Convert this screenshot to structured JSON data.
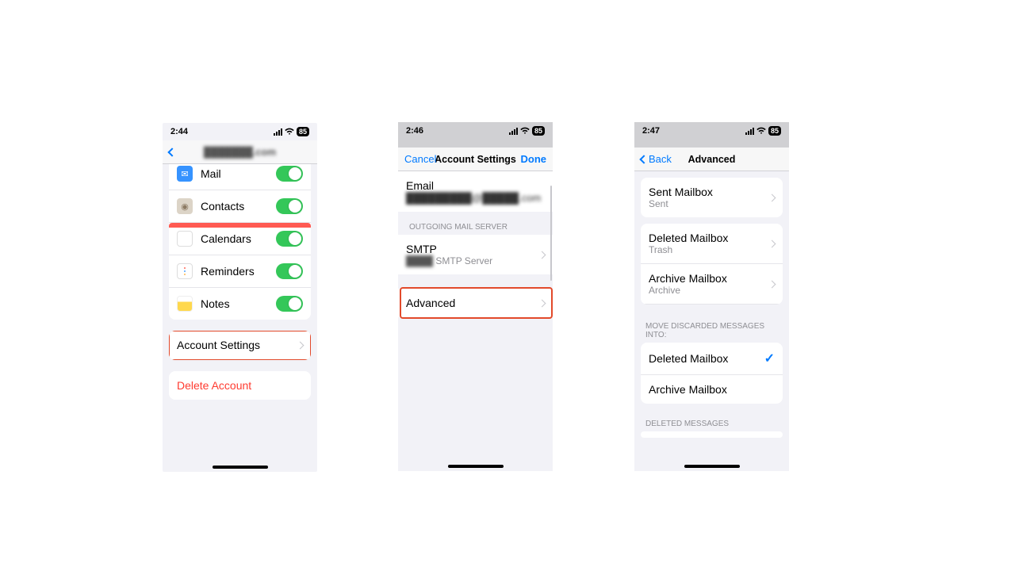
{
  "screens": {
    "a": {
      "time": "2:44",
      "battery": "85",
      "title": "███████.com",
      "list": [
        {
          "name": "Mail",
          "iconBg": "#3693ff"
        },
        {
          "name": "Contacts",
          "iconBg": "#c7b29b"
        },
        {
          "name": "Calendars",
          "iconBg": "#ff5a52"
        },
        {
          "name": "Reminders",
          "iconBg": "#ffffff"
        },
        {
          "name": "Notes",
          "iconBg": "#ffd84d"
        }
      ],
      "accountSettings": "Account Settings",
      "deleteAccount": "Delete Account"
    },
    "b": {
      "time": "2:46",
      "battery": "85",
      "cancel": "Cancel",
      "title": "Account Settings",
      "done": "Done",
      "emailLabel": "Email",
      "emailValue": "█████████@█████.com",
      "sectionOutgoing": "OUTGOING MAIL SERVER",
      "smtpLabel": "SMTP",
      "smtpServer": "████ SMTP Server",
      "advanced": "Advanced"
    },
    "c": {
      "time": "2:47",
      "battery": "85",
      "back": "Back",
      "title": "Advanced",
      "sentLabel": "Sent Mailbox",
      "sentValue": "Sent",
      "deletedLabel": "Deleted Mailbox",
      "deletedValue": "Trash",
      "archiveLabel": "Archive Mailbox",
      "archiveValue": "Archive",
      "moveHeader": "MOVE DISCARDED MESSAGES INTO:",
      "optDeleted": "Deleted Mailbox",
      "optArchive": "Archive Mailbox",
      "deletedHeader": "DELETED MESSAGES"
    }
  }
}
